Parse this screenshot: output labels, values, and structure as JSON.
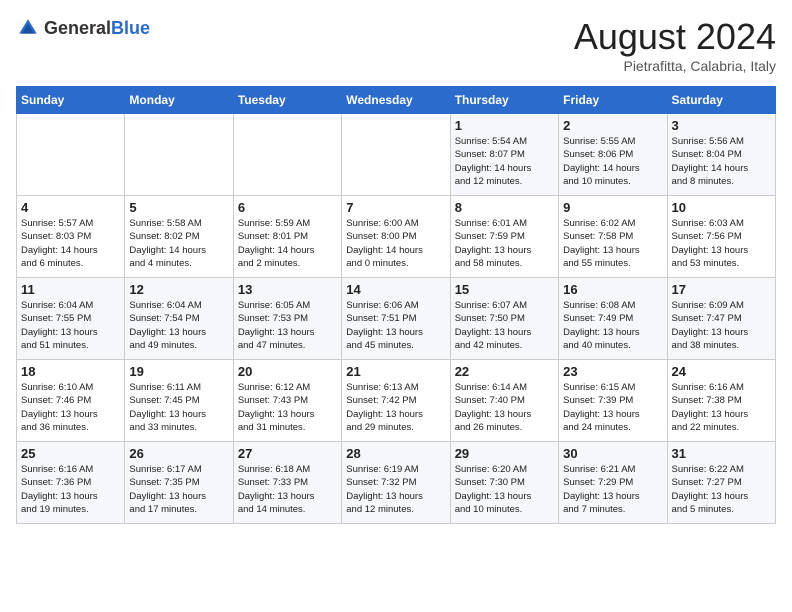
{
  "logo": {
    "general": "General",
    "blue": "Blue"
  },
  "title": "August 2024",
  "subtitle": "Pietrafitta, Calabria, Italy",
  "weekdays": [
    "Sunday",
    "Monday",
    "Tuesday",
    "Wednesday",
    "Thursday",
    "Friday",
    "Saturday"
  ],
  "weeks": [
    [
      {
        "day": "",
        "info": ""
      },
      {
        "day": "",
        "info": ""
      },
      {
        "day": "",
        "info": ""
      },
      {
        "day": "",
        "info": ""
      },
      {
        "day": "1",
        "info": "Sunrise: 5:54 AM\nSunset: 8:07 PM\nDaylight: 14 hours\nand 12 minutes."
      },
      {
        "day": "2",
        "info": "Sunrise: 5:55 AM\nSunset: 8:06 PM\nDaylight: 14 hours\nand 10 minutes."
      },
      {
        "day": "3",
        "info": "Sunrise: 5:56 AM\nSunset: 8:04 PM\nDaylight: 14 hours\nand 8 minutes."
      }
    ],
    [
      {
        "day": "4",
        "info": "Sunrise: 5:57 AM\nSunset: 8:03 PM\nDaylight: 14 hours\nand 6 minutes."
      },
      {
        "day": "5",
        "info": "Sunrise: 5:58 AM\nSunset: 8:02 PM\nDaylight: 14 hours\nand 4 minutes."
      },
      {
        "day": "6",
        "info": "Sunrise: 5:59 AM\nSunset: 8:01 PM\nDaylight: 14 hours\nand 2 minutes."
      },
      {
        "day": "7",
        "info": "Sunrise: 6:00 AM\nSunset: 8:00 PM\nDaylight: 14 hours\nand 0 minutes."
      },
      {
        "day": "8",
        "info": "Sunrise: 6:01 AM\nSunset: 7:59 PM\nDaylight: 13 hours\nand 58 minutes."
      },
      {
        "day": "9",
        "info": "Sunrise: 6:02 AM\nSunset: 7:58 PM\nDaylight: 13 hours\nand 55 minutes."
      },
      {
        "day": "10",
        "info": "Sunrise: 6:03 AM\nSunset: 7:56 PM\nDaylight: 13 hours\nand 53 minutes."
      }
    ],
    [
      {
        "day": "11",
        "info": "Sunrise: 6:04 AM\nSunset: 7:55 PM\nDaylight: 13 hours\nand 51 minutes."
      },
      {
        "day": "12",
        "info": "Sunrise: 6:04 AM\nSunset: 7:54 PM\nDaylight: 13 hours\nand 49 minutes."
      },
      {
        "day": "13",
        "info": "Sunrise: 6:05 AM\nSunset: 7:53 PM\nDaylight: 13 hours\nand 47 minutes."
      },
      {
        "day": "14",
        "info": "Sunrise: 6:06 AM\nSunset: 7:51 PM\nDaylight: 13 hours\nand 45 minutes."
      },
      {
        "day": "15",
        "info": "Sunrise: 6:07 AM\nSunset: 7:50 PM\nDaylight: 13 hours\nand 42 minutes."
      },
      {
        "day": "16",
        "info": "Sunrise: 6:08 AM\nSunset: 7:49 PM\nDaylight: 13 hours\nand 40 minutes."
      },
      {
        "day": "17",
        "info": "Sunrise: 6:09 AM\nSunset: 7:47 PM\nDaylight: 13 hours\nand 38 minutes."
      }
    ],
    [
      {
        "day": "18",
        "info": "Sunrise: 6:10 AM\nSunset: 7:46 PM\nDaylight: 13 hours\nand 36 minutes."
      },
      {
        "day": "19",
        "info": "Sunrise: 6:11 AM\nSunset: 7:45 PM\nDaylight: 13 hours\nand 33 minutes."
      },
      {
        "day": "20",
        "info": "Sunrise: 6:12 AM\nSunset: 7:43 PM\nDaylight: 13 hours\nand 31 minutes."
      },
      {
        "day": "21",
        "info": "Sunrise: 6:13 AM\nSunset: 7:42 PM\nDaylight: 13 hours\nand 29 minutes."
      },
      {
        "day": "22",
        "info": "Sunrise: 6:14 AM\nSunset: 7:40 PM\nDaylight: 13 hours\nand 26 minutes."
      },
      {
        "day": "23",
        "info": "Sunrise: 6:15 AM\nSunset: 7:39 PM\nDaylight: 13 hours\nand 24 minutes."
      },
      {
        "day": "24",
        "info": "Sunrise: 6:16 AM\nSunset: 7:38 PM\nDaylight: 13 hours\nand 22 minutes."
      }
    ],
    [
      {
        "day": "25",
        "info": "Sunrise: 6:16 AM\nSunset: 7:36 PM\nDaylight: 13 hours\nand 19 minutes."
      },
      {
        "day": "26",
        "info": "Sunrise: 6:17 AM\nSunset: 7:35 PM\nDaylight: 13 hours\nand 17 minutes."
      },
      {
        "day": "27",
        "info": "Sunrise: 6:18 AM\nSunset: 7:33 PM\nDaylight: 13 hours\nand 14 minutes."
      },
      {
        "day": "28",
        "info": "Sunrise: 6:19 AM\nSunset: 7:32 PM\nDaylight: 13 hours\nand 12 minutes."
      },
      {
        "day": "29",
        "info": "Sunrise: 6:20 AM\nSunset: 7:30 PM\nDaylight: 13 hours\nand 10 minutes."
      },
      {
        "day": "30",
        "info": "Sunrise: 6:21 AM\nSunset: 7:29 PM\nDaylight: 13 hours\nand 7 minutes."
      },
      {
        "day": "31",
        "info": "Sunrise: 6:22 AM\nSunset: 7:27 PM\nDaylight: 13 hours\nand 5 minutes."
      }
    ]
  ]
}
